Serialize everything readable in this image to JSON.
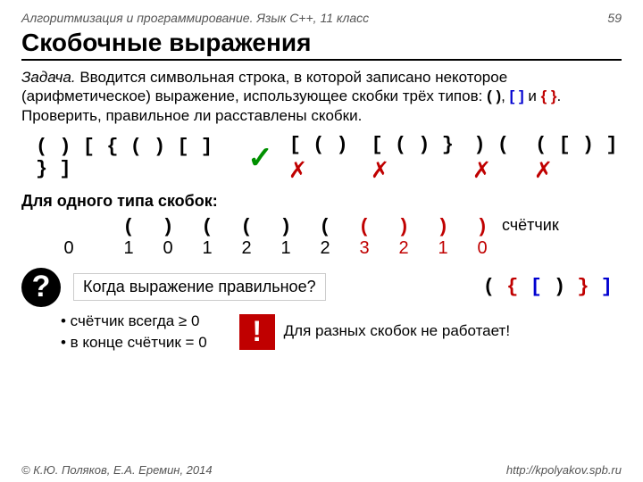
{
  "header": {
    "left": "Алгоритмизация и программирование. Язык C++, 11 класс",
    "page": "59"
  },
  "title": "Скобочные выражения",
  "task": {
    "lead": "Задача.",
    "body": " Вводится символьная строка, в которой записано некоторое (арифметическое) выражение, использующее скобки трёх типов: ",
    "br1": "( )",
    "sep1": ", ",
    "br2": "[ ]",
    "sep2": " и ",
    "br3": "{ }",
    "tail": ". Проверить, правильное ли расставлены скобки."
  },
  "examples": {
    "ok": "( ) [ { ( ) [ ] } ]",
    "bad": [
      "[ ( )",
      "[ ( ) }",
      ") (",
      "( [ ) ]"
    ]
  },
  "sub": "Для одного типа скобок:",
  "table": {
    "label": "счётчик",
    "chars": [
      "(",
      ")",
      "(",
      "(",
      ")",
      "(",
      "(",
      ")",
      ")",
      ")"
    ],
    "vals": [
      "0",
      "1",
      "0",
      "1",
      "2",
      "1",
      "2",
      "3",
      "2",
      "1",
      "0"
    ]
  },
  "question": "Когда выражение правильное?",
  "extraExpr": "( { [ ) } ]",
  "bullets": [
    "• счётчик всегда ≥ 0",
    "• в конце счётчик = 0"
  ],
  "warn": "Для разных скобок не работает!",
  "footer": {
    "left": "© К.Ю. Поляков, Е.А. Еремин, 2014",
    "right": "http://kpolyakov.spb.ru"
  }
}
